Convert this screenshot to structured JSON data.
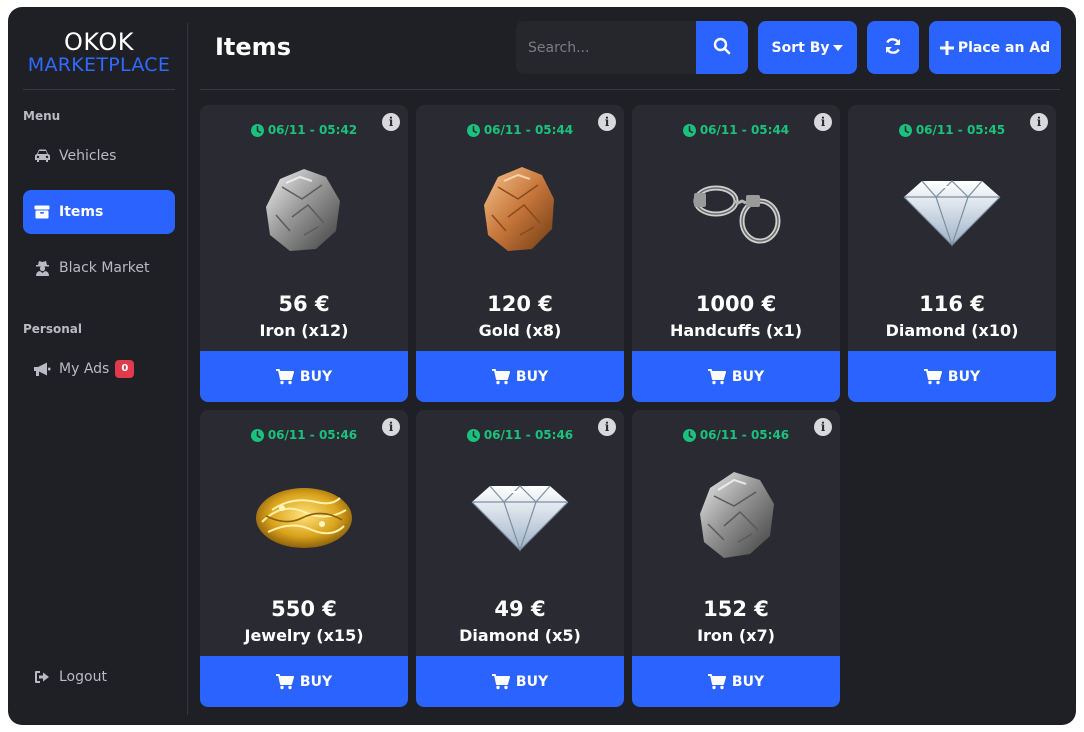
{
  "logo": {
    "top": "OKOK",
    "bottom": "MARKETPLACE"
  },
  "sidebar": {
    "menu_label": "Menu",
    "items": [
      {
        "label": "Vehicles",
        "icon": "car-icon",
        "active": false
      },
      {
        "label": "Items",
        "icon": "box-icon",
        "active": true
      },
      {
        "label": "Black Market",
        "icon": "user-secret-icon",
        "active": false
      }
    ],
    "personal_label": "Personal",
    "my_ads": {
      "label": "My Ads",
      "badge": "0",
      "icon": "megaphone-icon"
    },
    "logout_label": "Logout"
  },
  "header": {
    "title": "Items",
    "search_placeholder": "Search...",
    "sort_label": "Sort By",
    "place_ad_label": "Place an Ad"
  },
  "colors": {
    "accent": "#2b63ff",
    "time": "#19c37d",
    "badge": "#e03b4c",
    "background": "#1f1f26",
    "card": "#2a2a32"
  },
  "items": [
    {
      "time": "06/11 - 05:42",
      "price": "56 €",
      "name": "Iron (x12)",
      "buy_label": "BUY",
      "image": "iron-ore"
    },
    {
      "time": "06/11 - 05:44",
      "price": "120 €",
      "name": "Gold (x8)",
      "buy_label": "BUY",
      "image": "gold-nugget"
    },
    {
      "time": "06/11 - 05:44",
      "price": "1000 €",
      "name": "Handcuffs (x1)",
      "buy_label": "BUY",
      "image": "handcuffs"
    },
    {
      "time": "06/11 - 05:45",
      "price": "116 €",
      "name": "Diamond (x10)",
      "buy_label": "BUY",
      "image": "diamond"
    },
    {
      "time": "06/11 - 05:46",
      "price": "550 €",
      "name": "Jewelry (x15)",
      "buy_label": "BUY",
      "image": "jewelry"
    },
    {
      "time": "06/11 - 05:46",
      "price": "49 €",
      "name": "Diamond (x5)",
      "buy_label": "BUY",
      "image": "diamond"
    },
    {
      "time": "06/11 - 05:46",
      "price": "152 €",
      "name": "Iron (x7)",
      "buy_label": "BUY",
      "image": "iron-ore"
    }
  ]
}
